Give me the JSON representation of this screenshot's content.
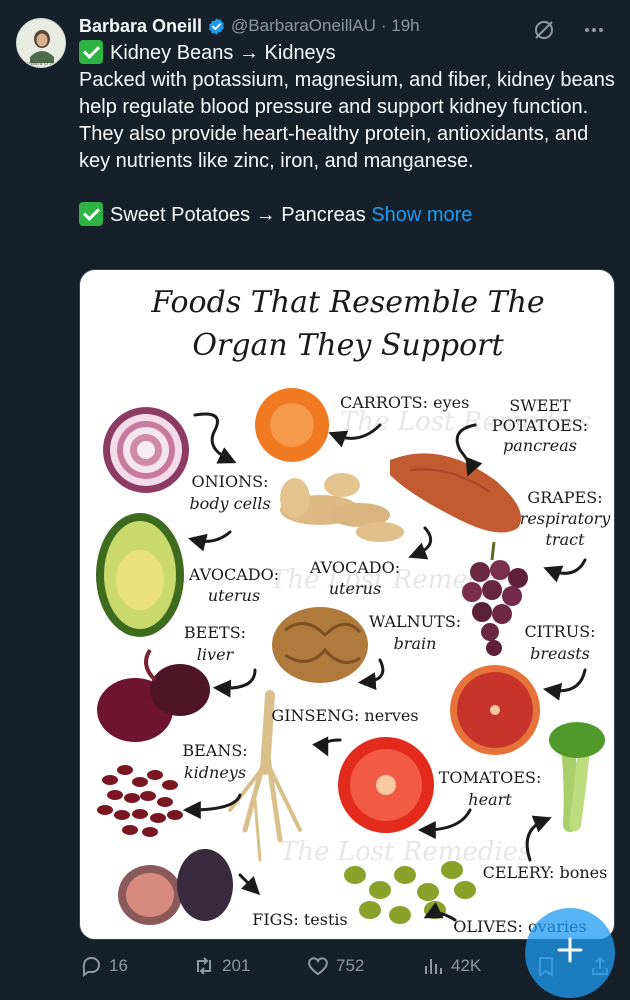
{
  "tweet": {
    "author_name": "Barbara Oneill",
    "handle": "@BarbaraOneillAU",
    "time": "· 19h",
    "avatar_text": "Barbara O'Neill",
    "line1": "Kidney Beans → Kidneys",
    "body": "Packed with potassium, magnesium, and fiber, kidney beans help regulate blood pressure and support kidney function. They also provide heart-healthy protein, antioxidants, and key nutrients like zinc, iron, and manganese.",
    "line2": "Sweet Potatoes → Pancreas",
    "show_more": "Show more"
  },
  "infographic": {
    "title_line1": "Foods That Resemble The",
    "title_line2": "Organ They Support",
    "watermark": "The Lost Remedies",
    "labels": {
      "carrots": "CARROTS: eyes",
      "sweet1": "SWEET",
      "sweet2": "POTATOES:",
      "sweet3": "pancreas",
      "onions1": "ONIONS:",
      "onions2": "body cells",
      "grapes1": "GRAPES:",
      "grapes2": "respiratory",
      "grapes3": "tract",
      "avocado_left1": "AVOCADO:",
      "avocado_left2": "uterus",
      "avocado_mid1": "AVOCADO:",
      "avocado_mid2": "uterus",
      "beets1": "BEETS:",
      "beets2": "liver",
      "walnuts1": "WALNUTS:",
      "walnuts2": "brain",
      "citrus1": "CITRUS:",
      "citrus2": "breasts",
      "ginseng": "GINSENG: nerves",
      "beans1": "BEANS:",
      "beans2": "kidneys",
      "tomatoes1": "TOMATOES:",
      "tomatoes2": "heart",
      "celery": "CELERY: bones",
      "figs": "FIGS: testis",
      "olives": "OLIVES: ovaries"
    }
  },
  "actions": {
    "replies": "16",
    "retweets": "201",
    "likes": "752",
    "views": "42K"
  },
  "colors": {
    "background": "#15202b",
    "accent": "#1d9bf0",
    "muted": "#8b98a5"
  }
}
